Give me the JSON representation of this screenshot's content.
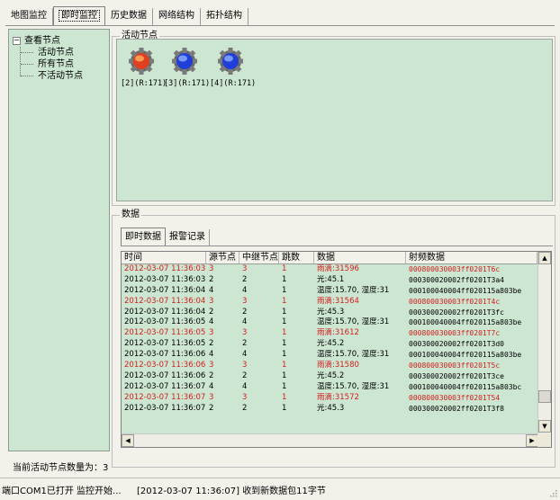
{
  "top_tabs": [
    "地图监控",
    "即时监控",
    "历史数据",
    "网络结构",
    "拓扑结构"
  ],
  "active_top_tab": "即时监控",
  "tree": {
    "root": "查看节点",
    "expander": "−",
    "children": [
      "活动节点",
      "所有节点",
      "不活动节点"
    ]
  },
  "active_node_count_label": "当前活动节点数量为：3",
  "active_nodes_group": {
    "title": "活动节点"
  },
  "nodes": [
    {
      "label": "[2](R:171)",
      "icon": "gear-red-node-icon",
      "color": "#e04020"
    },
    {
      "label": "[3](R:171)",
      "icon": "gear-blue-node-icon",
      "color": "#1f3fd8"
    },
    {
      "label": "[4](R:171)",
      "icon": "gear-blue-node-icon",
      "color": "#1f3fd8"
    }
  ],
  "data_group": {
    "title": "数据"
  },
  "sub_tabs": [
    "即时数据",
    "报警记录"
  ],
  "active_sub_tab": "即时数据",
  "table": {
    "columns": [
      "时间",
      "源节点",
      "中继节点",
      "跳数",
      "数据",
      "射频数据"
    ],
    "rows": [
      {
        "red": true,
        "time": "2012-03-07 11:36:03",
        "src": "3",
        "relay": "3",
        "hops": "1",
        "data": "雨滴:31596",
        "rf": "000800030003ff0201T6c"
      },
      {
        "red": false,
        "time": "2012-03-07 11:36:03",
        "src": "2",
        "relay": "2",
        "hops": "1",
        "data": "光:45.1",
        "rf": "000300020002ff0201T3a4"
      },
      {
        "red": false,
        "time": "2012-03-07 11:36:04",
        "src": "4",
        "relay": "4",
        "hops": "1",
        "data": "温度:15.70, 湿度:31",
        "rf": "000100040004ff020115a803be"
      },
      {
        "red": true,
        "time": "2012-03-07 11:36:04",
        "src": "3",
        "relay": "3",
        "hops": "1",
        "data": "雨滴:31564",
        "rf": "000800030003ff0201T4c"
      },
      {
        "red": false,
        "time": "2012-03-07 11:36:04",
        "src": "2",
        "relay": "2",
        "hops": "1",
        "data": "光:45.3",
        "rf": "000300020002ff0201T3fc"
      },
      {
        "red": false,
        "time": "2012-03-07 11:36:05",
        "src": "4",
        "relay": "4",
        "hops": "1",
        "data": "温度:15.70, 湿度:31",
        "rf": "000100040004ff020115a803be"
      },
      {
        "red": true,
        "time": "2012-03-07 11:36:05",
        "src": "3",
        "relay": "3",
        "hops": "1",
        "data": "雨滴:31612",
        "rf": "000800030003ff0201T7c"
      },
      {
        "red": false,
        "time": "2012-03-07 11:36:05",
        "src": "2",
        "relay": "2",
        "hops": "1",
        "data": "光:45.2",
        "rf": "000300020002ff0201T3d0"
      },
      {
        "red": false,
        "time": "2012-03-07 11:36:06",
        "src": "4",
        "relay": "4",
        "hops": "1",
        "data": "温度:15.70, 湿度:31",
        "rf": "000100040004ff020115a803be"
      },
      {
        "red": true,
        "time": "2012-03-07 11:36:06",
        "src": "3",
        "relay": "3",
        "hops": "1",
        "data": "雨滴:31580",
        "rf": "000800030003ff0201T5c"
      },
      {
        "red": false,
        "time": "2012-03-07 11:36:06",
        "src": "2",
        "relay": "2",
        "hops": "1",
        "data": "光:45.2",
        "rf": "000300020002ff0201T3ce"
      },
      {
        "red": false,
        "time": "2012-03-07 11:36:07",
        "src": "4",
        "relay": "4",
        "hops": "1",
        "data": "温度:15.70, 湿度:31",
        "rf": "000100040004ff020115a803bc"
      },
      {
        "red": true,
        "time": "2012-03-07 11:36:07",
        "src": "3",
        "relay": "3",
        "hops": "1",
        "data": "雨滴:31572",
        "rf": "000800030003ff0201T54"
      },
      {
        "red": false,
        "time": "2012-03-07 11:36:07",
        "src": "2",
        "relay": "2",
        "hops": "1",
        "data": "光:45.3",
        "rf": "000300020002ff0201T3f8"
      }
    ]
  },
  "scroll": {
    "up": "▲",
    "down": "▼",
    "left": "◀",
    "right": "▶"
  },
  "status_bar": {
    "port_status": "端口COM1已打开 监控开始...",
    "last_message": "[2012-03-07 11:36:07]  收到新数据包11字节"
  },
  "colors": {
    "panel_green": "#cce6d1",
    "alarm_red": "#d21e1e"
  }
}
